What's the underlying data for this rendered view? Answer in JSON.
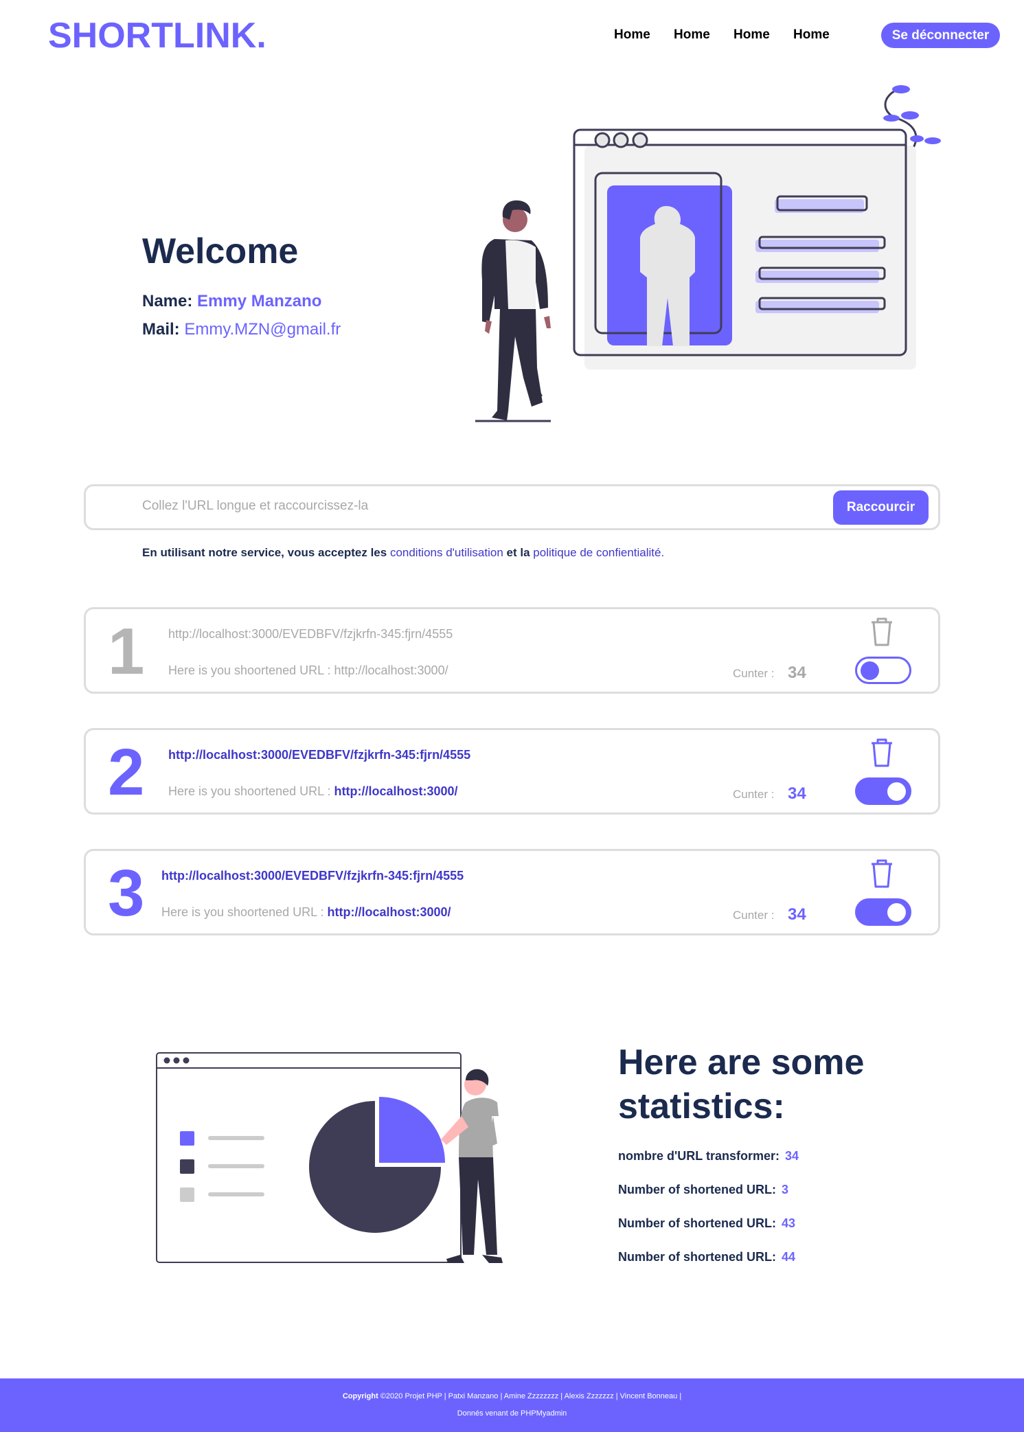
{
  "header": {
    "logo": "SHORTLINK.",
    "nav": [
      "Home",
      "Home",
      "Home",
      "Home"
    ],
    "logout_label": "Se déconnecter"
  },
  "welcome": {
    "title": "Welcome",
    "name_label": "Name:",
    "name_value": "Emmy Manzano",
    "mail_label": "Mail:",
    "mail_value": "Emmy.MZN@gmail.fr"
  },
  "shorten_form": {
    "placeholder": "Collez l'URL longue et raccourcissez-la",
    "button_label": "Raccourcir"
  },
  "terms": {
    "prefix": "En utilisant notre service, vous acceptez les",
    "link1": "conditions d'utilisation",
    "middle": "et la",
    "link2": "politique de confientialité."
  },
  "links": [
    {
      "number": "1",
      "long_url": "http://localhost:3000/EVEDBFV/fzjkrfn-345:fjrn/4555",
      "short_label": "Here is you shoortened URL :",
      "short_url": "http://localhost:3000/",
      "counter_label": "Cunter :",
      "counter_value": "34",
      "enabled": false
    },
    {
      "number": "2",
      "long_url": "http://localhost:3000/EVEDBFV/fzjkrfn-345:fjrn/4555",
      "short_label": "Here is you shoortened URL :",
      "short_url": "http://localhost:3000/",
      "counter_label": "Cunter :",
      "counter_value": "34",
      "enabled": true
    },
    {
      "number": "3",
      "long_url": "http://localhost:3000/EVEDBFV/fzjkrfn-345:fjrn/4555",
      "short_label": "Here is you shoortened URL :",
      "short_url": "http://localhost:3000/",
      "counter_label": "Cunter :",
      "counter_value": "34",
      "enabled": true
    }
  ],
  "stats": {
    "title_line1": "Here are some",
    "title_line2": "statistics:",
    "items": [
      {
        "label": "nombre d'URL transformer:",
        "value": "34"
      },
      {
        "label": "Number of shortened URL:",
        "value": "3"
      },
      {
        "label": "Number of shortened URL:",
        "value": "43"
      },
      {
        "label": "Number of shortened URL:",
        "value": "44"
      }
    ]
  },
  "footer": {
    "copyright_label": "Copyright",
    "line1": "©2020 Projet PHP | Patxi Manzano | Amine Zzzzzzzz | Alexis Zzzzzzz | Vincent Bonneau |",
    "line2": "Donnés venant de PHPMyadmin"
  },
  "colors": {
    "accent": "#6c63ff",
    "dark_text": "#1b2a4e",
    "link_blue": "#3f37c9",
    "muted": "#a8a8a8"
  }
}
